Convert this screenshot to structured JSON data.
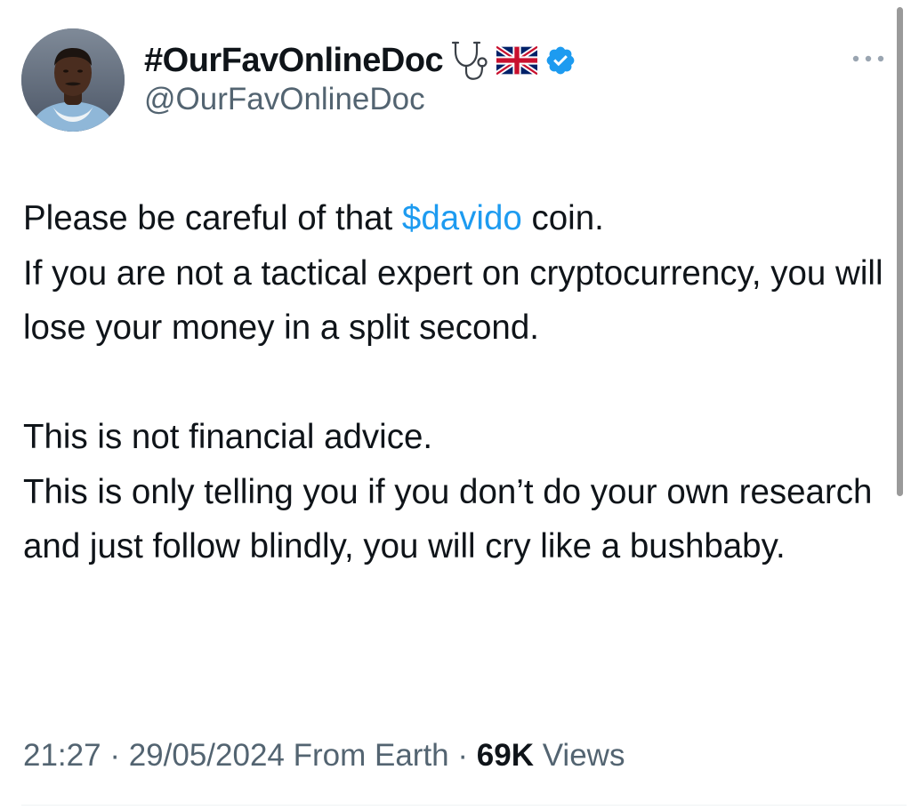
{
  "author": {
    "display_name": "#OurFavOnlineDoc",
    "handle": "@OurFavOnlineDoc",
    "name_icons": [
      "stethoscope-icon",
      "uk-flag-icon",
      "verified-badge-icon"
    ]
  },
  "tweet": {
    "paragraph1": {
      "line1_before": "Please be careful of that ",
      "cashtag": "$davido",
      "line1_after": " coin.",
      "rest": "If you are not a tactical expert on cryptocurrency, you will lose your money in a split second."
    },
    "paragraph2": {
      "line1": "This is not financial advice.",
      "rest": "This is only telling you if you don’t do your own research and just follow blindly, you will cry like a bushbaby."
    }
  },
  "meta": {
    "time": "21:27",
    "separator": " · ",
    "date": "29/05/2024",
    "source": "From Earth",
    "views_count": "69K",
    "views_label": "Views"
  },
  "colors": {
    "link": "#1d9bf0",
    "secondary_text": "#536471",
    "primary_text": "#0f1419",
    "verified": "#1d9bf0"
  }
}
